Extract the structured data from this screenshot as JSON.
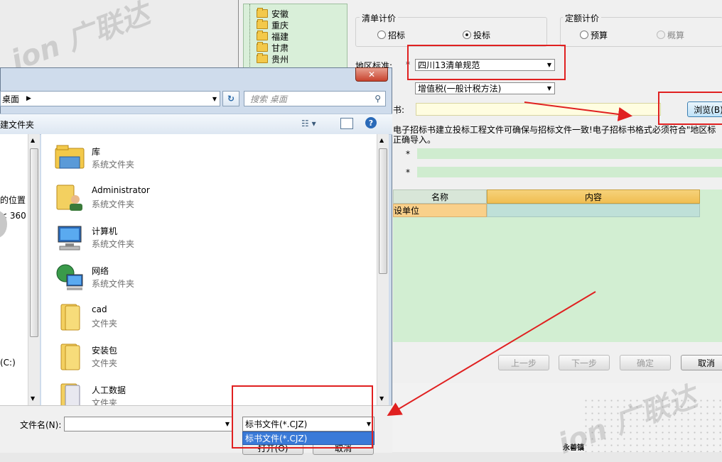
{
  "wizard": {
    "tree_items": [
      "安徽",
      "重庆",
      "福建",
      "甘肃",
      "贵州"
    ],
    "qingdan": {
      "title": "清单计价",
      "opt1": "招标",
      "opt2": "投标"
    },
    "dinge": {
      "title": "定额计价",
      "opt1": "预算",
      "opt2": "概算"
    },
    "region_label": "地区标准:",
    "required_mark": "*",
    "region_value": "四川13清单规范",
    "tax_value": "增值税(一般计税方法)",
    "file_label": "书:",
    "browse_label": "浏览(B)",
    "notice": "电子招标书建立投标工程文件可确保与招标文件一致!电子招标书格式必须符合\"地区标",
    "notice2": "正确导入。",
    "grid_headers": [
      "名称",
      "内容"
    ],
    "grid_row": [
      "设单位",
      ""
    ],
    "buttons": {
      "prev": "上一步",
      "next": "下一步",
      "ok": "确定",
      "cancel": "取消"
    }
  },
  "dialog": {
    "close_label": "✕",
    "address": "桌面",
    "search_placeholder": "搜索 桌面",
    "new_folder": "建文件夹",
    "left_items": [
      "的位置",
      "< 360",
      "(C:)"
    ],
    "files": [
      {
        "name": "库",
        "type": "系统文件夹",
        "icon": "library-icon"
      },
      {
        "name": "Administrator",
        "type": "系统文件夹",
        "icon": "user-folder-icon"
      },
      {
        "name": "计算机",
        "type": "系统文件夹",
        "icon": "computer-icon"
      },
      {
        "name": "网络",
        "type": "系统文件夹",
        "icon": "network-icon"
      },
      {
        "name": "cad",
        "type": "文件夹",
        "icon": "folder-icon"
      },
      {
        "name": "安装包",
        "type": "文件夹",
        "icon": "folder-icon"
      },
      {
        "name": "人工数据",
        "type": "文件夹",
        "icon": "folder-icon"
      }
    ],
    "filename_label": "文件名(N):",
    "filename_value": "",
    "filetype_value": "标书文件(*.CJZ)",
    "filetype_options": [
      "标书文件(*.CJZ)"
    ],
    "open_label": "打开(O)",
    "cancel_label": "取消"
  },
  "map_label": "永善镇",
  "watermark": "ion 广联达"
}
